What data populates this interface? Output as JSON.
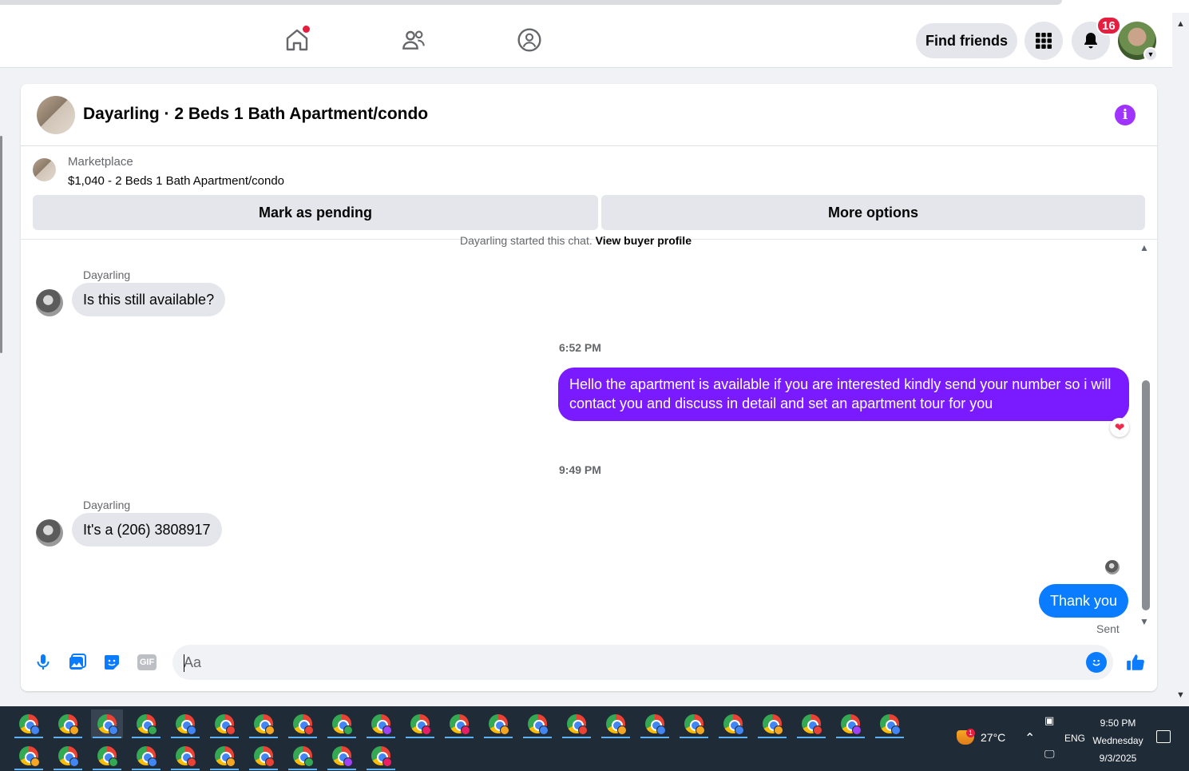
{
  "navbar": {
    "find_friends_label": "Find friends",
    "notification_count": "16"
  },
  "chat": {
    "title": "Dayarling · 2 Beds 1 Bath Apartment/condo",
    "listing": {
      "source": "Marketplace",
      "price_title": "$1,040 - 2 Beds 1 Bath Apartment/condo",
      "mark_pending_label": "Mark as pending",
      "more_options_label": "More options"
    },
    "started_text_prefix": "Dayarling started this chat.",
    "started_link": "View buyer profile",
    "messages": [
      {
        "sender": "Dayarling",
        "text": "Is this still available?"
      },
      {
        "timestamp": "6:52 PM"
      },
      {
        "text": "Hello the apartment is available if you are interested kindly send your number so i will contact you and discuss in detail and set an apartment tour for you",
        "reaction": "heart"
      },
      {
        "timestamp": "9:49 PM"
      },
      {
        "sender": "Dayarling",
        "text": "It's a (206) 3808917"
      },
      {
        "text": "Thank you",
        "status": "Sent"
      }
    ],
    "composer_placeholder": "Aa"
  },
  "taskbar": {
    "temperature": "27°C",
    "language": "ENG",
    "time": "9:50 PM",
    "day": "Wednesday",
    "date": "9/3/2025",
    "weather_alert_count": "1"
  },
  "colors": {
    "accent_purple": "#7a1bff",
    "accent_blue": "#0a7cff",
    "badge_red": "#e41e3f",
    "taskbar": "#202b38"
  }
}
